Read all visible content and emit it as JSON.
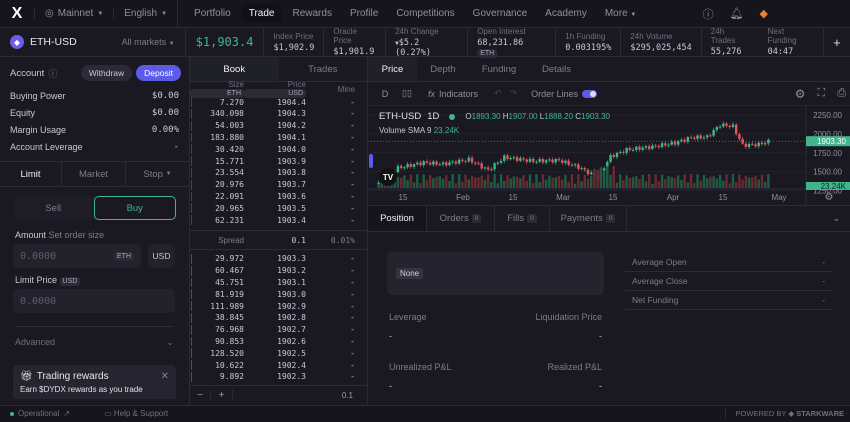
{
  "nav": {
    "network": "Mainnet",
    "language": "English",
    "items": [
      "Portfolio",
      "Trade",
      "Rewards",
      "Profile",
      "Competitions",
      "Governance",
      "Academy",
      "More"
    ],
    "active": "Trade"
  },
  "market": {
    "symbol": "ETH-USD",
    "all_markets": "All markets",
    "price": "$1,903.4",
    "stats": [
      {
        "label": "Index Price",
        "value": "$1,902.9"
      },
      {
        "label": "Oracle Price",
        "value": "$1,901.9"
      },
      {
        "label": "24h Change",
        "value": "$5.2 (0.27%)"
      },
      {
        "label": "Open Interest",
        "value": "68,231.86",
        "unit": "ETH"
      },
      {
        "label": "1h Funding",
        "value": "0.003195%"
      },
      {
        "label": "24h Volume",
        "value": "$295,025,454"
      },
      {
        "label": "24h Trades",
        "value": "55,276"
      },
      {
        "label": "Next Funding",
        "value": "04:47"
      }
    ],
    "add": "+"
  },
  "account": {
    "title": "Account",
    "withdraw": "Withdraw",
    "deposit": "Deposit",
    "rows": [
      {
        "label": "Buying Power",
        "value": "$0.00"
      },
      {
        "label": "Equity",
        "value": "$0.00"
      },
      {
        "label": "Margin Usage",
        "value": "0.00%"
      },
      {
        "label": "Account Leverage",
        "value": "-"
      }
    ]
  },
  "order": {
    "types": [
      "Limit",
      "Market",
      "Stop"
    ],
    "sell": "Sell",
    "buy": "Buy",
    "amount_label": "Amount",
    "amount_hint": "Set order size",
    "amount_placeholder": "0.0000",
    "amount_unit": "ETH",
    "usd_toggle": "USD",
    "limit_label": "Limit Price",
    "limit_unit": "USD",
    "limit_placeholder": "0.0000",
    "advanced": "Advanced",
    "rewards_title": "Trading rewards",
    "rewards_text": "Earn $DYDX rewards as you trade"
  },
  "book": {
    "tabs": [
      "Book",
      "Trades"
    ],
    "headers": {
      "size": "Size",
      "size_unit": "ETH",
      "price": "Price",
      "price_unit": "USD",
      "mine": "Mine"
    },
    "asks": [
      [
        "7.270",
        "1904.4"
      ],
      [
        "340.098",
        "1904.3"
      ],
      [
        "54.003",
        "1904.2"
      ],
      [
        "183.880",
        "1904.1"
      ],
      [
        "30.420",
        "1904.0"
      ],
      [
        "15.771",
        "1903.9"
      ],
      [
        "23.554",
        "1903.8"
      ],
      [
        "20.976",
        "1903.7"
      ],
      [
        "22.091",
        "1903.6"
      ],
      [
        "20.965",
        "1903.5"
      ],
      [
        "62.231",
        "1903.4"
      ]
    ],
    "spread": {
      "label": "Spread",
      "value": "0.1",
      "pct": "0.01%"
    },
    "bids": [
      [
        "29.972",
        "1903.3"
      ],
      [
        "60.467",
        "1903.2"
      ],
      [
        "45.751",
        "1903.1"
      ],
      [
        "81.919",
        "1903.0"
      ],
      [
        "111.989",
        "1902.9"
      ],
      [
        "38.845",
        "1902.8"
      ],
      [
        "76.968",
        "1902.7"
      ],
      [
        "90.853",
        "1902.6"
      ],
      [
        "128.520",
        "1902.5"
      ],
      [
        "10.622",
        "1902.4"
      ],
      [
        "9.892",
        "1902.3"
      ]
    ],
    "mine": "-",
    "minus": "−",
    "plus": "+",
    "grouping": "0.1"
  },
  "chart": {
    "tabs": [
      "Price",
      "Depth",
      "Funding",
      "Details"
    ],
    "interval": "D",
    "indicators": "Indicators",
    "order_lines": "Order Lines",
    "order_lines_on": true,
    "symbol": "ETH-USD",
    "tf": "1D",
    "o": "1893.30",
    "h": "1907.00",
    "l": "1888.20",
    "c": "1903.30",
    "volume_label": "Volume SMA 9",
    "volume_value": "23.24K",
    "last_price_label": "1903.30",
    "volume_badge": "23.24K",
    "y_ticks": [
      "2250.00",
      "2000.00",
      "1750.00",
      "1500.00",
      "1250.00"
    ],
    "x_ticks": [
      "15",
      "Feb",
      "15",
      "Mar",
      "15",
      "Apr",
      "15",
      "May"
    ],
    "price_keypoints": [
      [
        0,
        1350
      ],
      [
        6,
        1550
      ],
      [
        14,
        1620
      ],
      [
        20,
        1600
      ],
      [
        28,
        1660
      ],
      [
        34,
        1520
      ],
      [
        39,
        1690
      ],
      [
        48,
        1640
      ],
      [
        56,
        1650
      ],
      [
        62,
        1560
      ],
      [
        68,
        1420
      ],
      [
        72,
        1700
      ],
      [
        77,
        1790
      ],
      [
        85,
        1830
      ],
      [
        92,
        1880
      ],
      [
        97,
        1950
      ],
      [
        102,
        1960
      ],
      [
        106,
        2120
      ],
      [
        110,
        2100
      ],
      [
        113,
        1850
      ],
      [
        118,
        1860
      ],
      [
        121,
        1900
      ]
    ]
  },
  "positions": {
    "tabs": [
      {
        "label": "Position"
      },
      {
        "label": "Orders",
        "count": "0"
      },
      {
        "label": "Fills",
        "count": "0"
      },
      {
        "label": "Payments",
        "count": "0"
      }
    ],
    "side": "None",
    "leverage": "Leverage",
    "liq": "Liquidation Price",
    "upnl": "Unrealized P&L",
    "rpnl": "Realized P&L",
    "dash": "-",
    "details": [
      {
        "label": "Average Open",
        "value": "-"
      },
      {
        "label": "Average Close",
        "value": "-"
      },
      {
        "label": "Net Funding",
        "value": "-"
      }
    ]
  },
  "footer": {
    "status": "Operational",
    "help": "Help & Support",
    "powered": "POWERED BY",
    "brand": "STARKWARE"
  },
  "colors": {
    "green": "#3fb68b",
    "red": "#e2555b",
    "accent": "#5c5ce8"
  }
}
